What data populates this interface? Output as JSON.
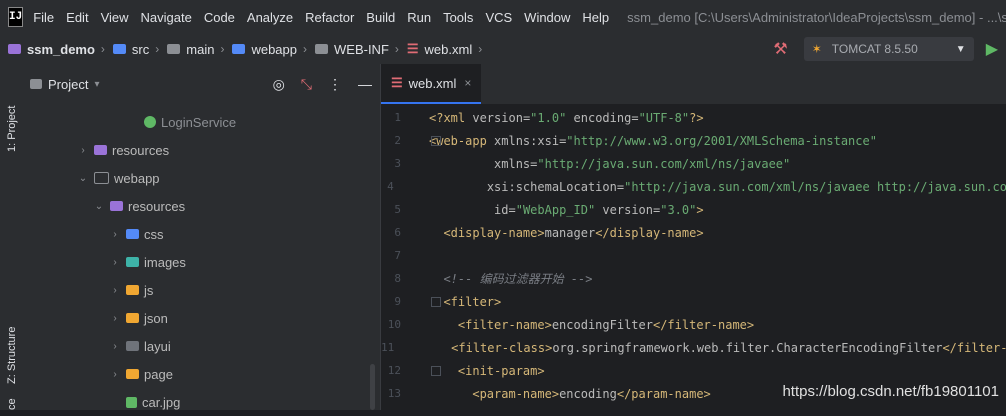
{
  "menubar": {
    "logo": "IJ",
    "items": [
      "File",
      "Edit",
      "View",
      "Navigate",
      "Code",
      "Analyze",
      "Refactor",
      "Build",
      "Run",
      "Tools",
      "VCS",
      "Window",
      "Help"
    ],
    "title": "ssm_demo [C:\\Users\\Administrator\\IdeaProjects\\ssm_demo] - ...\\s"
  },
  "breadcrumb": [
    "ssm_demo",
    "src",
    "main",
    "webapp",
    "WEB-INF",
    "web.xml"
  ],
  "run": {
    "config": "TOMCAT 8.5.50"
  },
  "stripe": {
    "project_tab": "1: Project",
    "structure_tab": "Z: Structure",
    "extra": "ce"
  },
  "project_panel": {
    "title": "Project"
  },
  "tree": [
    {
      "label": "LoginService",
      "arrow": ""
    },
    {
      "label": "resources",
      "arrow": "›"
    },
    {
      "label": "webapp",
      "arrow": "⌄"
    },
    {
      "label": "resources",
      "arrow": "⌄"
    },
    {
      "label": "css",
      "arrow": "›"
    },
    {
      "label": "images",
      "arrow": "›"
    },
    {
      "label": "js",
      "arrow": "›"
    },
    {
      "label": "json",
      "arrow": "›"
    },
    {
      "label": "layui",
      "arrow": "›"
    },
    {
      "label": "page",
      "arrow": "›"
    },
    {
      "label": "car.jpg",
      "arrow": ""
    }
  ],
  "editor": {
    "tab_label": "web.xml",
    "line_numbers": [
      "1",
      "2",
      "3",
      "4",
      "5",
      "6",
      "7",
      "8",
      "9",
      "10",
      "11",
      "12",
      "13"
    ]
  },
  "watermark": "https://blog.csdn.net/fb19801101",
  "colors": {
    "accent": "#3574f0",
    "tag": "#d5b778",
    "string": "#6aab73",
    "comment": "#7a7e85"
  }
}
